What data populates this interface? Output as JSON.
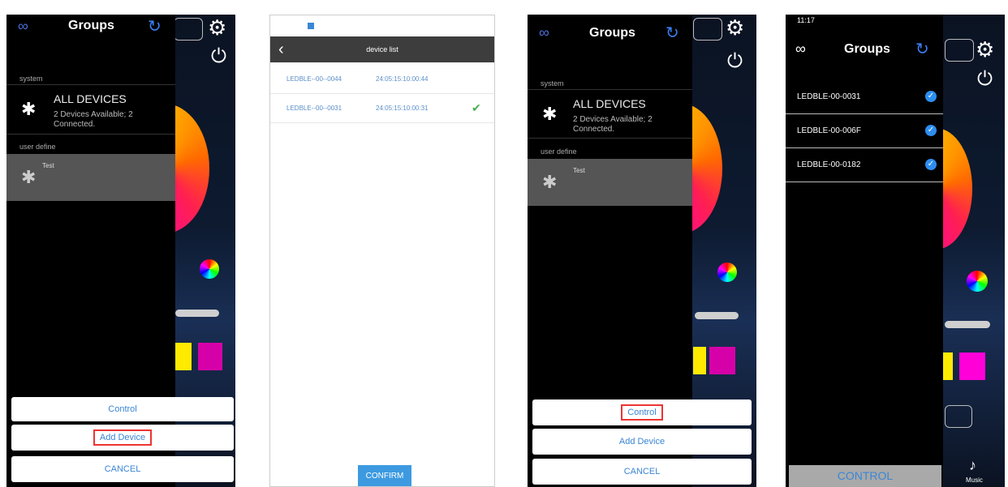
{
  "panels": {
    "groups_menu": {
      "title": "Groups",
      "section_system": "system",
      "all_devices_title": "ALL DEVICES",
      "all_devices_sub": "2 Devices Available; 2 Connected.",
      "section_user": "user define",
      "test_group": "Test",
      "btn_control": "Control",
      "btn_add_device": "Add Device",
      "btn_cancel": "CANCEL"
    },
    "device_list": {
      "title": "device list",
      "rows": [
        {
          "name": "LEDBLE--00--0044",
          "time": "24:05:15:10:00:44",
          "checked": false
        },
        {
          "name": "LEDBLE--00--0031",
          "time": "24:05:15:10:00:31",
          "checked": true
        }
      ],
      "confirm": "CONFIRM"
    },
    "groups_menu_2": {
      "title": "Groups",
      "section_system": "system",
      "all_devices_title": "ALL DEVICES",
      "all_devices_sub": "2 Devices Available; 2 Connected.",
      "section_user": "user define",
      "test_group": "Test",
      "btn_control": "Control",
      "btn_add_device": "Add Device",
      "btn_cancel": "CANCEL"
    },
    "group_devices": {
      "status_time": "11:17",
      "title": "Groups",
      "devices": [
        "LEDBLE-00-0031",
        "LEDBLE-00-006F",
        "LEDBLE-00-0182"
      ],
      "control": "CONTROL",
      "music_label": "Music"
    }
  },
  "colors": {
    "accent_blue": "#3a86d6",
    "check_green": "#4caf50",
    "highlight_red": "#e33333",
    "swatch_yellow": "#ffea00",
    "swatch_magenta": "#d600a8"
  },
  "icons": {
    "link": "link-icon",
    "refresh": "refresh-icon",
    "gear": "gear-icon",
    "power": "power-icon",
    "bluetooth": "bluetooth-icon",
    "back": "back-chevron-icon",
    "check": "checkmark-icon",
    "music": "music-note-icon"
  }
}
